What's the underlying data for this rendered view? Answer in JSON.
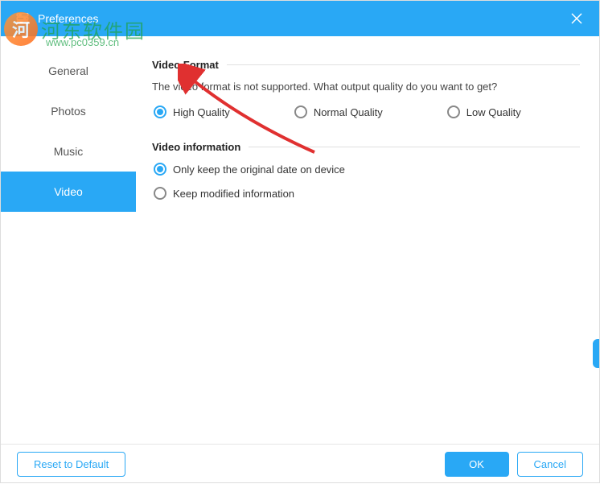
{
  "titlebar": {
    "title": "Preferences"
  },
  "sidebar": {
    "items": [
      {
        "label": "General",
        "active": false
      },
      {
        "label": "Photos",
        "active": false
      },
      {
        "label": "Music",
        "active": false
      },
      {
        "label": "Video",
        "active": true
      }
    ]
  },
  "sections": {
    "videoFormat": {
      "title": "Video Format",
      "description": "The video format is not supported. What output quality do you want to get?",
      "options": [
        {
          "label": "High Quality",
          "selected": true
        },
        {
          "label": "Normal Quality",
          "selected": false
        },
        {
          "label": "Low Quality",
          "selected": false
        }
      ]
    },
    "videoInfo": {
      "title": "Video information",
      "options": [
        {
          "label": "Only keep the original date on device",
          "selected": true
        },
        {
          "label": "Keep modified information",
          "selected": false
        }
      ]
    }
  },
  "footer": {
    "reset": "Reset to Default",
    "ok": "OK",
    "cancel": "Cancel"
  },
  "watermark": {
    "cn": "河东软件园",
    "url": "www.pc0359.cn"
  },
  "colors": {
    "primary": "#29a8f5",
    "watermarkGreen": "#1fa34a",
    "watermarkOrange": "#ff7a2a",
    "arrowRed": "#e03030"
  }
}
